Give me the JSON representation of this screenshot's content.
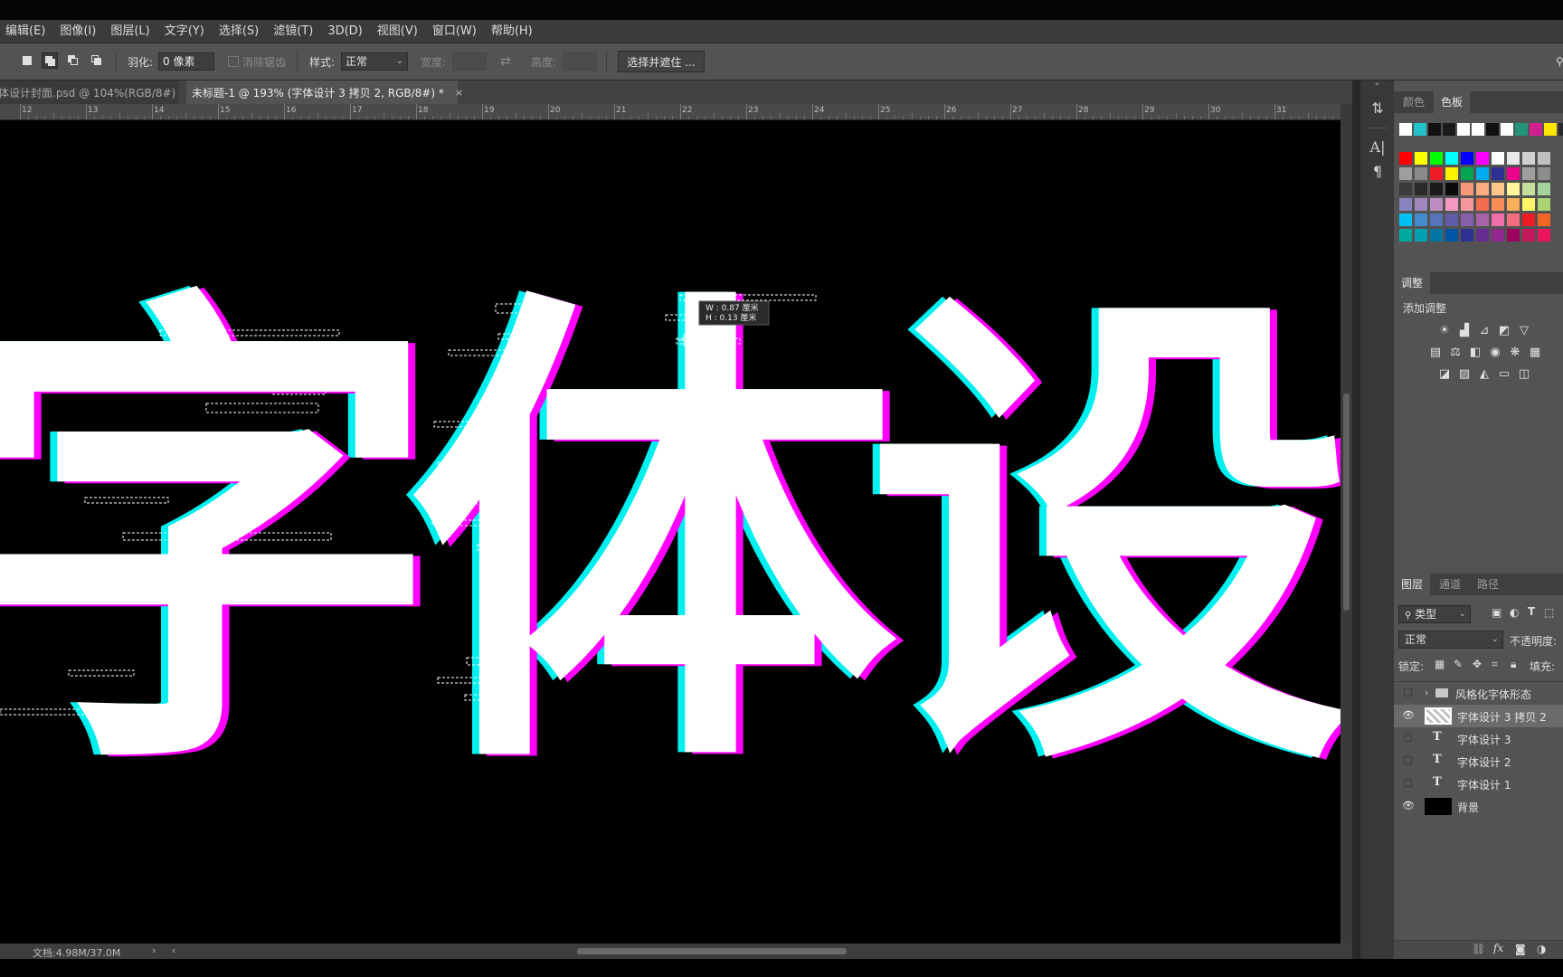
{
  "menu": [
    "编辑(E)",
    "图像(I)",
    "图层(L)",
    "文字(Y)",
    "选择(S)",
    "滤镜(T)",
    "3D(D)",
    "视图(V)",
    "窗口(W)",
    "帮助(H)"
  ],
  "options": {
    "feather_label": "羽化:",
    "feather_value": "0 像素",
    "antialias_label": "消除锯齿",
    "style_label": "样式:",
    "style_value": "正常",
    "width_label": "宽度:",
    "height_label": "高度:",
    "select_mask_label": "选择并遮住 ..."
  },
  "tabs": [
    {
      "label": "体设计封面.psd @ 104%(RGB/8#)",
      "close": "×"
    },
    {
      "label": "未标题-1 @ 193% (字体设计 3 拷贝 2, RGB/8#) *",
      "close": "×"
    }
  ],
  "ruler": {
    "labels": [
      "12",
      "13",
      "14",
      "15",
      "16",
      "17",
      "18",
      "19",
      "20",
      "21",
      "22",
      "23",
      "24",
      "25",
      "26",
      "27",
      "28",
      "29",
      "30",
      "31"
    ]
  },
  "canvas": {
    "text_shown": "字体设",
    "measure_w": "W : 0.87 厘米",
    "measure_h": "H : 0.13 厘米",
    "colors": {
      "background": "#000000",
      "fill": "#ffffff",
      "cyan": "#00f0f0",
      "magenta": "#ff00ff",
      "yellow": "#ffff00"
    }
  },
  "status": {
    "doc_info": "文档:4.98M/37.0M",
    "arrow": "›",
    "scroll_left": "‹"
  },
  "icon_strip": [
    "layer-comps-icon",
    "character-icon",
    "paragraph-icon"
  ],
  "color_panel": {
    "tabs": [
      "颜色",
      "色板"
    ],
    "recent_swatches": [
      "#ffffff",
      "#22c0c8",
      "#111111",
      "#1a1a1a",
      "#ffffff",
      "#ffffff",
      "#111111",
      "#ffffff",
      "#23967a",
      "#d02090",
      "#ffe400",
      "#2a2a2a"
    ],
    "swatch_rows": [
      [
        "#ff0000",
        "#ffff00",
        "#00ff00",
        "#00ffff",
        "#0000ff",
        "#ff00ff",
        "#ffffff",
        "#e8e8e8",
        "#d0d0d0",
        "#c0c0c0"
      ],
      [
        "#9e9e9e",
        "#8a8a8a",
        "#ee1c24",
        "#fff200",
        "#00a651",
        "#00aeef",
        "#2e3192",
        "#ec008c",
        "#a0a0a0",
        "#8c8c8c"
      ],
      [
        "#3c3c3c",
        "#2a2a2a",
        "#1a1a1a",
        "#0a0a0a",
        "#f7977a",
        "#f9ad81",
        "#fdc68a",
        "#fff79a",
        "#c4df9b",
        "#a3d39c"
      ],
      [
        "#8882be",
        "#a187be",
        "#bc8dbf",
        "#f49ac2",
        "#f6989d",
        "#f26c4f",
        "#f68e56",
        "#fbaf5d",
        "#fff568",
        "#acd373"
      ],
      [
        "#00bff3",
        "#438ccb",
        "#5574b9",
        "#605ca8",
        "#855fa8",
        "#a763a8",
        "#f06ea9",
        "#f26d7d",
        "#ed1c24",
        "#f26522"
      ],
      [
        "#00a99d",
        "#00a0b0",
        "#0076a3",
        "#0054a6",
        "#2e3192",
        "#662d91",
        "#92278f",
        "#9e005d",
        "#c2185b",
        "#ed145b"
      ]
    ]
  },
  "adjustments": {
    "tab": "调整",
    "title": "添加调整",
    "rows": [
      [
        "brightness-icon",
        "levels-icon",
        "curves-icon",
        "exposure-icon",
        "vibrance-icon"
      ],
      [
        "hue-saturation-icon",
        "color-balance-icon",
        "black-white-icon",
        "photo-filter-icon",
        "channel-mixer-icon",
        "color-lookup-icon"
      ],
      [
        "invert-icon",
        "posterize-icon",
        "threshold-icon",
        "gradient-map-icon",
        "selective-color-icon"
      ]
    ]
  },
  "layers_panel": {
    "tabs": [
      "图层",
      "通道",
      "路径"
    ],
    "filter_label": "类型",
    "blend_mode": "正常",
    "opacity_label": "不透明度:",
    "lock_label": "锁定:",
    "fill_label": "填充:",
    "layers": [
      {
        "name": "风格化字体形态",
        "kind": "group",
        "visible": false,
        "selected": false
      },
      {
        "name": "字体设计 3 拷贝 2",
        "kind": "pixel",
        "visible": true,
        "selected": true
      },
      {
        "name": "字体设计 3",
        "kind": "text",
        "visible": false,
        "selected": false
      },
      {
        "name": "字体设计 2",
        "kind": "text",
        "visible": false,
        "selected": false
      },
      {
        "name": "字体设计 1",
        "kind": "text",
        "visible": false,
        "selected": false
      },
      {
        "name": "背景",
        "kind": "background",
        "visible": true,
        "selected": false
      }
    ],
    "footer_icons": [
      "link-icon",
      "fx-icon",
      "mask-icon",
      "adjustment-icon"
    ]
  }
}
